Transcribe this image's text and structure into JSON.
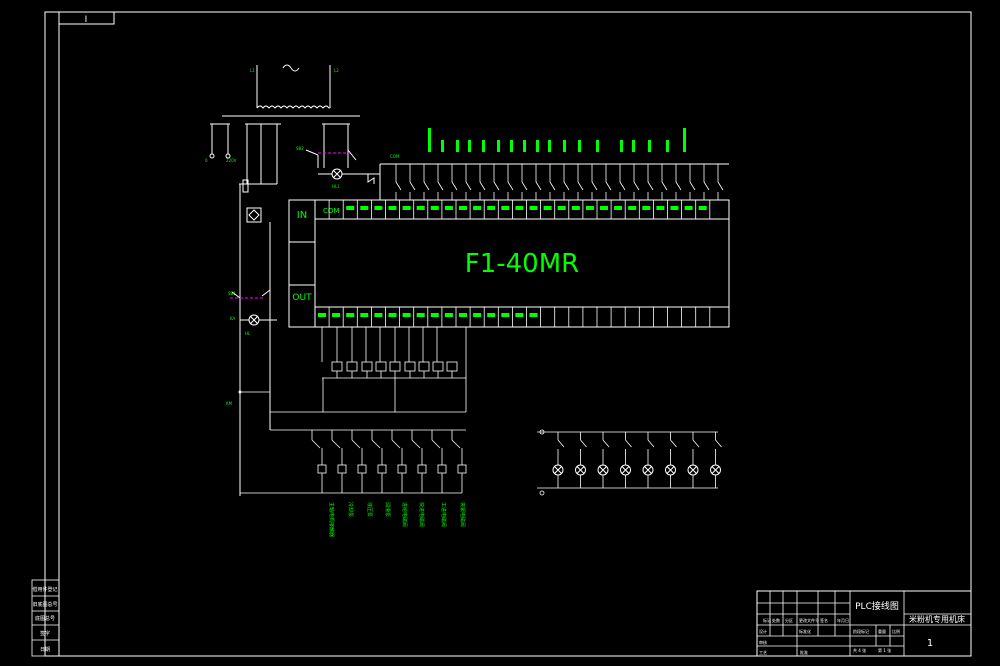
{
  "sheet": {
    "corner_tag": "I",
    "controller_model": "F1-40MR",
    "port_in": "IN",
    "port_out": "OUT",
    "port_com": "COM"
  },
  "title_block": {
    "drawing_title": "PLC接线图",
    "project_name": "米粉机专用机床",
    "sheet_number": "1",
    "labels": [
      "标记",
      "处数",
      "分区",
      "更改文件号",
      "签名",
      "年月日",
      "设计",
      "标准化",
      "审核",
      "工艺",
      "批准",
      "阶段标记",
      "重量",
      "比例",
      "共 4 张",
      "第 1 张"
    ]
  },
  "left_strip": {
    "labels": [
      "借用件登记",
      "旧底图总号",
      "底图总号",
      "签字",
      "日期"
    ]
  },
  "output_labels": [
    "主轴电机接触器",
    "冷却泵",
    "液压泵",
    "润滑泵",
    "进给电磁阀",
    "快进电磁阀",
    "工进电磁阀",
    "夹紧电磁阀"
  ],
  "input_label": "K",
  "lamp_count": 8,
  "colors": {
    "lines": "#ffffff",
    "labels": "#00ff00",
    "dashed": "#ff00ff",
    "background": "#000000"
  }
}
